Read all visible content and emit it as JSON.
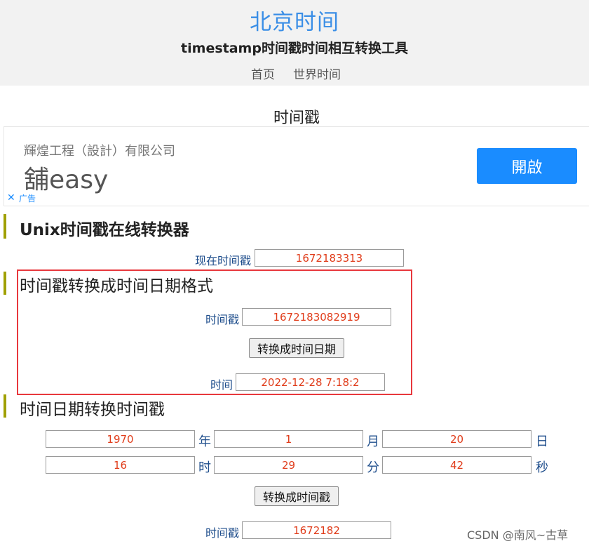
{
  "header": {
    "site_title": "北京时间",
    "subtitle": "timestamp时间戳时间相互转换工具",
    "nav": [
      "首页",
      "世界时间"
    ]
  },
  "page_heading": "时间戳",
  "ad": {
    "company": "輝煌工程（設計）有限公司",
    "brand": "舖easy",
    "open_label": "開啟",
    "close_icon": "✕",
    "ad_label": "广告",
    "accent_color": "#1a8cff"
  },
  "unix_section": {
    "title": "Unix时间戳在线转换器",
    "now_label": "现在时间戳",
    "now_value": "1672183313"
  },
  "ts_to_date": {
    "title": "时间戳转换成时间日期格式",
    "ts_label": "时间戳",
    "ts_value": "1672183082919",
    "button_label": "转换成时间日期",
    "result_label": "时间",
    "result_value": "2022-12-28 7:18:2"
  },
  "date_to_ts": {
    "title": "时间日期转换时间戳",
    "year_value": "1970",
    "year_unit": "年",
    "month_value": "1",
    "month_unit": "月",
    "day_value": "20",
    "day_unit": "日",
    "hour_value": "16",
    "hour_unit": "时",
    "minute_value": "29",
    "minute_unit": "分",
    "second_value": "42",
    "second_unit": "秒",
    "button_label": "转换成时间戳",
    "result_label": "时间戳",
    "result_value": "1672182"
  },
  "watermark": "CSDN @南风~古草",
  "colors": {
    "value_text": "#e03c1a",
    "label_text": "#1f4e8c",
    "title_blue": "#3a8ee6",
    "section_bar": "#a0a000",
    "highlight_border": "#e8383d"
  }
}
